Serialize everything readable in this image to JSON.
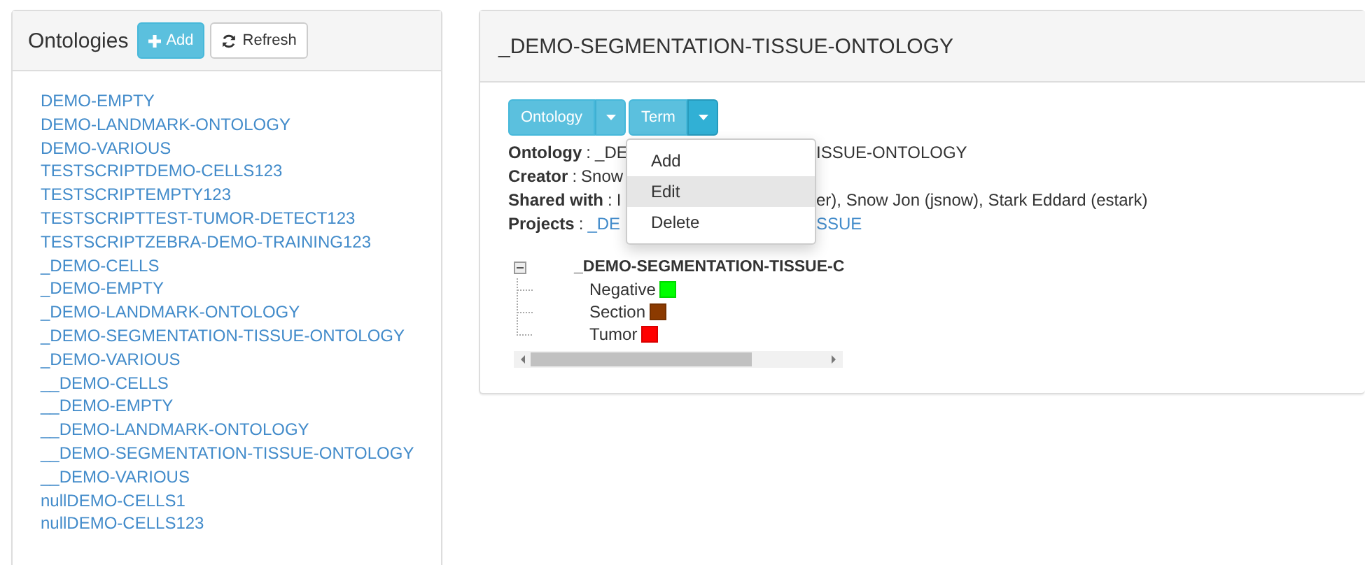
{
  "ontologies_panel": {
    "title": "Ontologies",
    "add_button": "Add",
    "refresh_button": "Refresh",
    "items": [
      "DEMO-EMPTY",
      "DEMO-LANDMARK-ONTOLOGY",
      "DEMO-VARIOUS",
      "TESTSCRIPTDEMO-CELLS123",
      "TESTSCRIPTEMPTY123",
      "TESTSCRIPTTEST-TUMOR-DETECT123",
      "TESTSCRIPTZEBRA-DEMO-TRAINING123",
      "_DEMO-CELLS",
      "_DEMO-EMPTY",
      "_DEMO-LANDMARK-ONTOLOGY",
      "_DEMO-SEGMENTATION-TISSUE-ONTOLOGY",
      "_DEMO-VARIOUS",
      "__DEMO-CELLS",
      "__DEMO-EMPTY",
      "__DEMO-LANDMARK-ONTOLOGY",
      "__DEMO-SEGMENTATION-TISSUE-ONTOLOGY",
      "__DEMO-VARIOUS",
      "nullDEMO-CELLS1",
      "nullDEMO-CELLS123"
    ]
  },
  "detail_panel": {
    "title": "_DEMO-SEGMENTATION-TISSUE-ONTOLOGY",
    "toolbar": [
      {
        "label": "Ontology",
        "selected": false
      },
      {
        "label": "Term",
        "selected": true
      }
    ],
    "menu": [
      {
        "label": "Add",
        "selected": false
      },
      {
        "label": "Edit",
        "selected": true
      },
      {
        "label": "Delete",
        "selected": false
      }
    ],
    "fields": [
      {
        "label": "Ontology",
        "kind": "text",
        "separator": ":",
        "left": "_DE",
        "right": "ISSUE-ONTOLOGY"
      },
      {
        "label": "Creator",
        "kind": "text",
        "separator": ":",
        "left": "Snow"
      },
      {
        "label": "Shared with",
        "kind": "text",
        "separator": ":",
        "left": "I",
        "right": "er), Snow Jon (jsnow), Stark Eddard (estark)"
      },
      {
        "label": "Projects",
        "kind": "link",
        "separator": ":",
        "left": "_DE",
        "right": "SSUE"
      }
    ],
    "tree": {
      "label": "_DEMO-SEGMENTATION-TISSUE-C",
      "expanded": true,
      "children": [
        {
          "label": "Negative",
          "color": "#00ff00"
        },
        {
          "label": "Section",
          "color": "#8b3a00"
        },
        {
          "label": "Tumor",
          "color": "#ff0000"
        }
      ]
    }
  }
}
